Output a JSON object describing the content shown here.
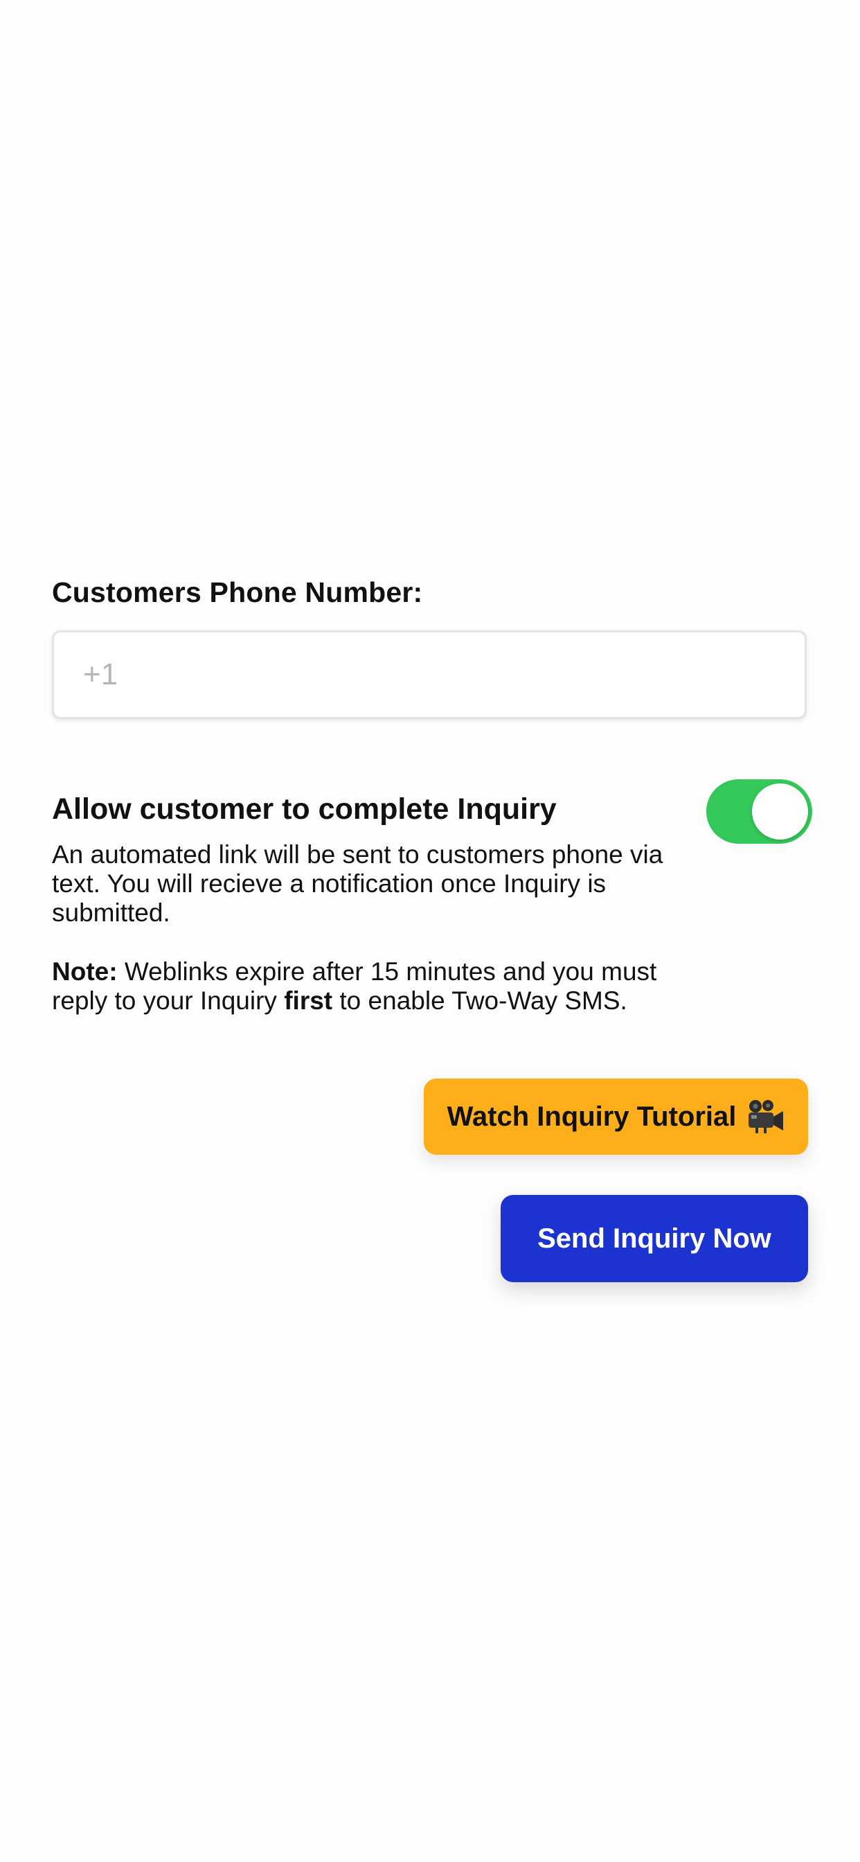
{
  "phone": {
    "label": "Customers Phone Number:",
    "placeholder": "+1",
    "value": ""
  },
  "allow": {
    "title": "Allow customer to complete Inquiry",
    "toggle_on": true,
    "description": "An automated  link will be sent to customers phone via text. You will recieve a notification once Inquiry is submitted."
  },
  "note": {
    "label": "Note:",
    "text_1": " Weblinks expire after 15 minutes and you must reply to your Inquiry ",
    "emphasis": "first",
    "text_2": " to enable Two-Way SMS."
  },
  "buttons": {
    "tutorial_label": "Watch Inquiry Tutorial",
    "tutorial_icon": "movie-camera-icon",
    "send_label": "Send Inquiry Now"
  },
  "colors": {
    "toggle_on": "#34c759",
    "tutorial_button": "#fdae1a",
    "send_button": "#1c33d0"
  }
}
